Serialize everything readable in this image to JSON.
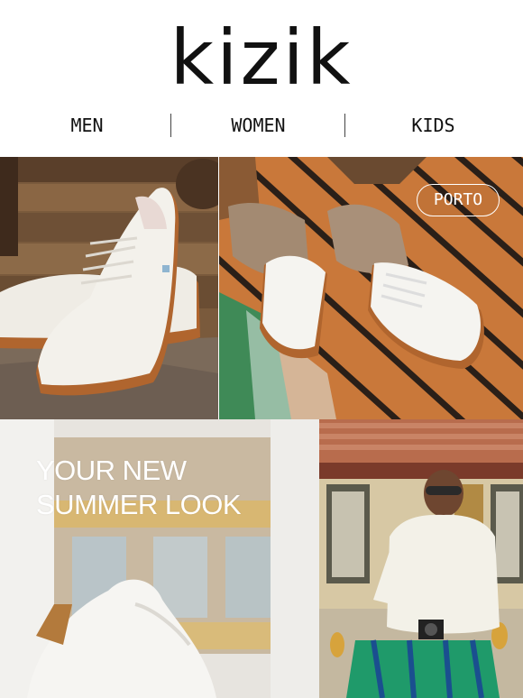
{
  "brand": {
    "logo_text": "kizik"
  },
  "nav": {
    "items": [
      {
        "label": "MEN"
      },
      {
        "label": "WOMEN"
      },
      {
        "label": "KIDS"
      }
    ]
  },
  "hero": {
    "badge_label": "PORTO",
    "headline_line1": "YOUR NEW",
    "headline_line2": "SUMMER LOOK"
  },
  "colors": {
    "text": "#111111",
    "gum_sole": "#b0652e",
    "deck_wood": "#c8783a",
    "shoe_white": "#f2f0ea"
  }
}
